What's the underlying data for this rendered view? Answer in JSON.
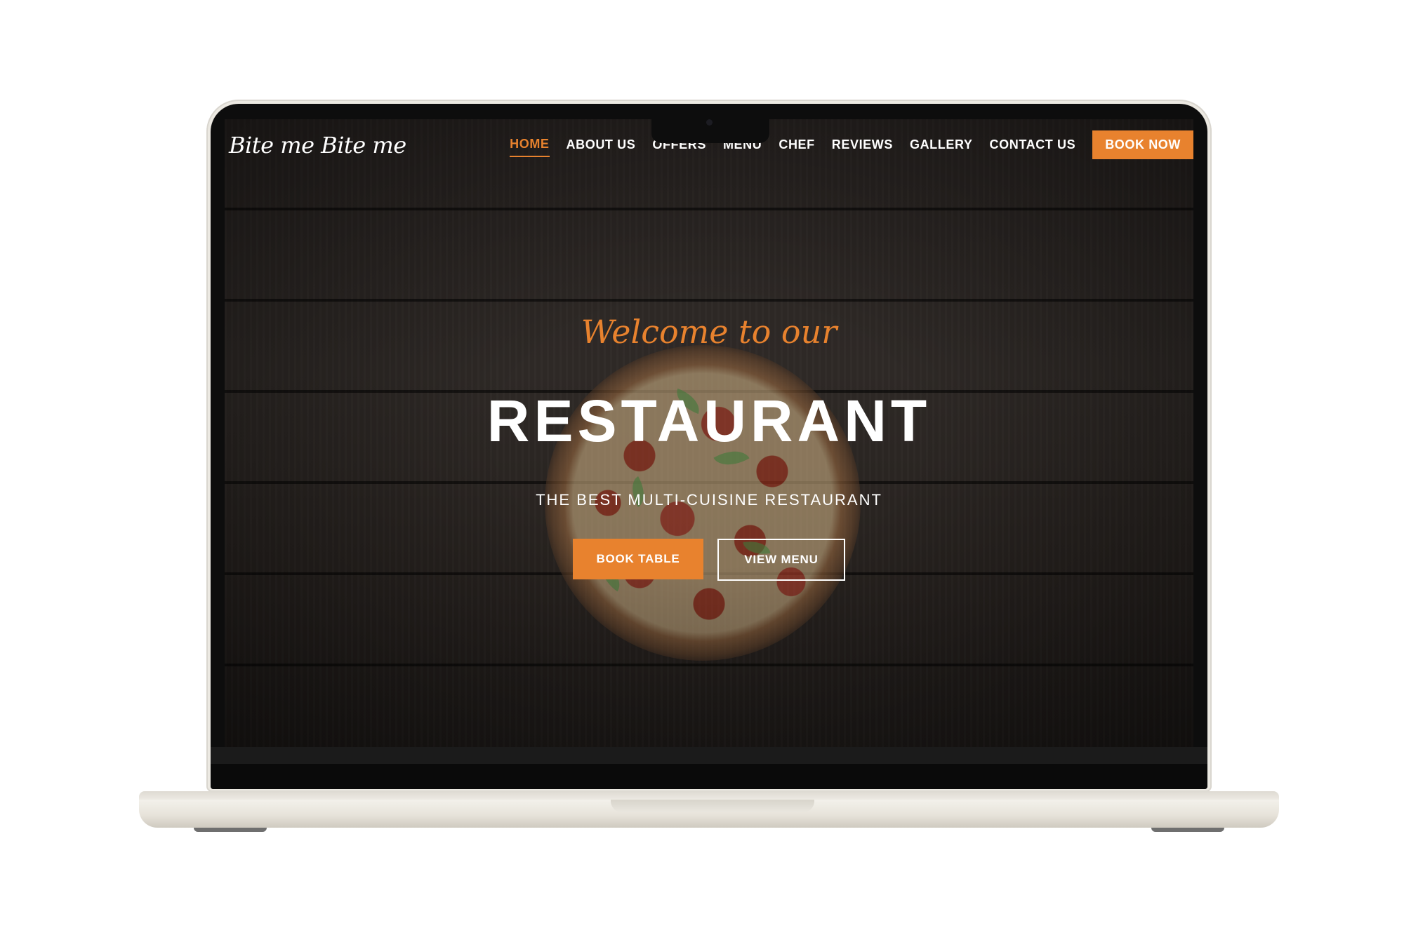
{
  "brand": {
    "logo_text": "Bite me  Bite me"
  },
  "nav": {
    "items": [
      {
        "label": "HOME",
        "active": true
      },
      {
        "label": "ABOUT US",
        "active": false
      },
      {
        "label": "OFFERS",
        "active": false
      },
      {
        "label": "MENU",
        "active": false
      },
      {
        "label": "CHEF",
        "active": false
      },
      {
        "label": "REVIEWS",
        "active": false
      },
      {
        "label": "GALLERY",
        "active": false
      },
      {
        "label": "CONTACT US",
        "active": false
      }
    ],
    "cta_label": "BOOK NOW"
  },
  "hero": {
    "welcome": "Welcome to our",
    "title": "RESTAURANT",
    "subtitle": "THE BEST MULTI-CUISINE RESTAURANT",
    "primary_button": "BOOK TABLE",
    "secondary_button": "VIEW MENU"
  },
  "colors": {
    "accent": "#e8822e",
    "background": "#2a2523",
    "text": "#ffffff"
  }
}
